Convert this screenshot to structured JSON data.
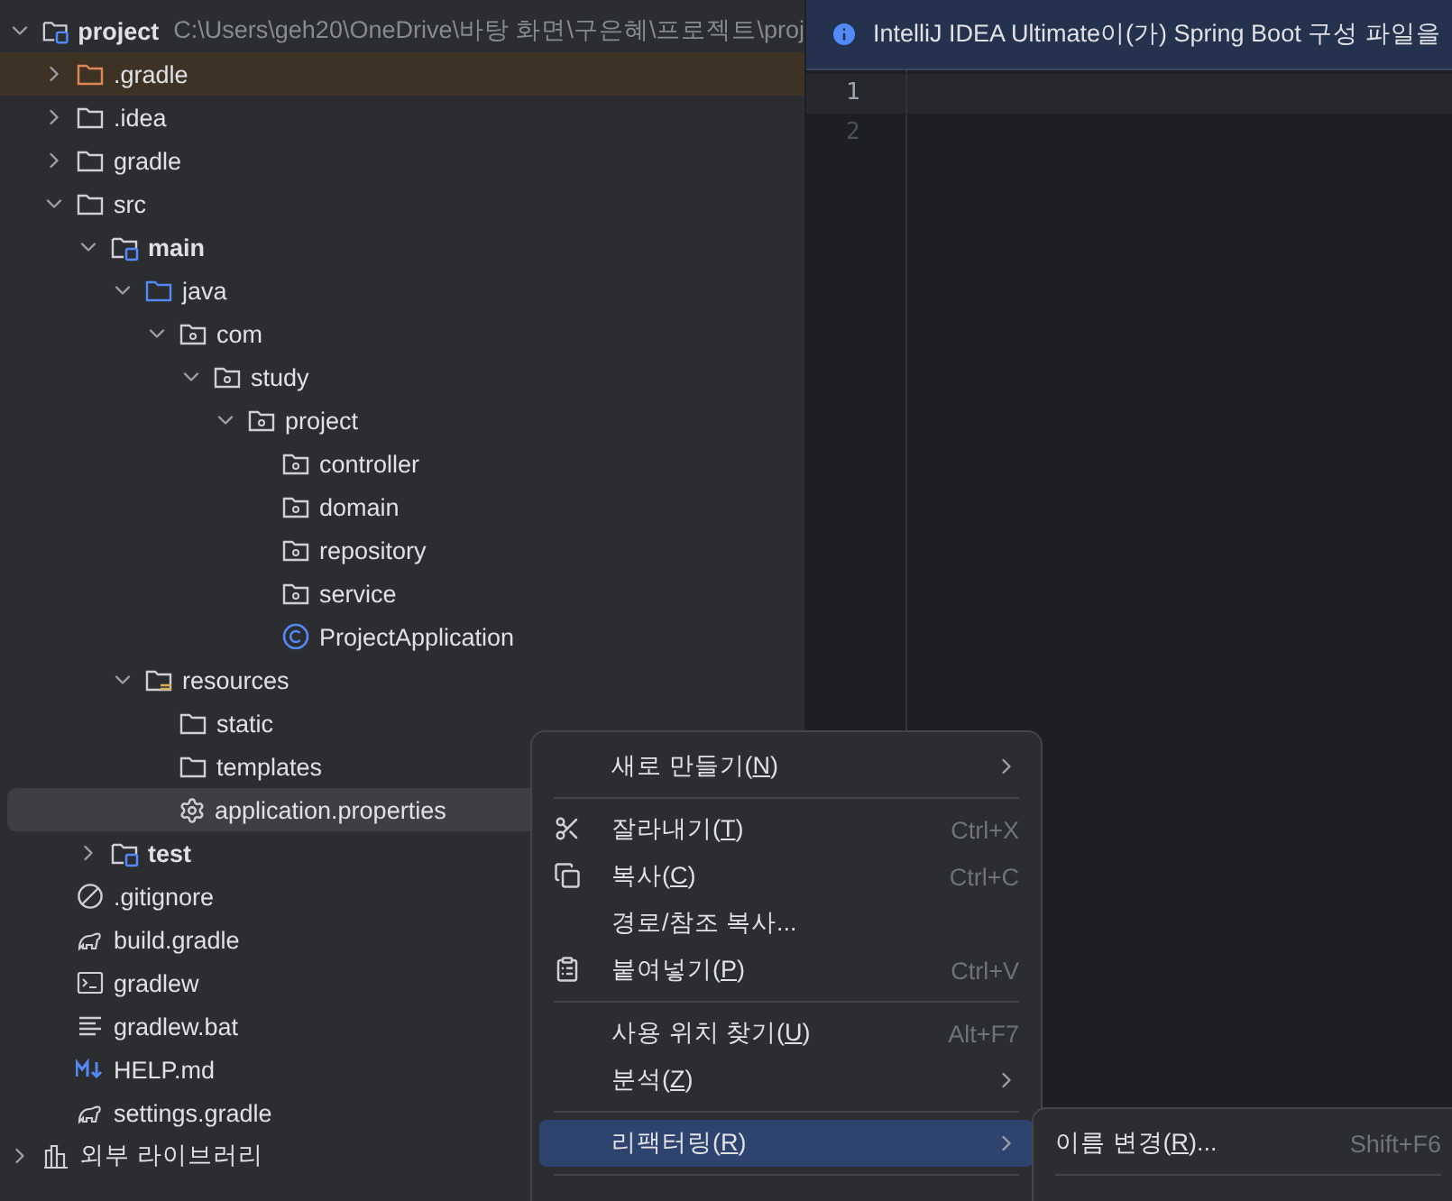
{
  "project_tree": [
    {
      "label": "project",
      "hint": "C:\\Users\\geh20\\OneDrive\\바탕 화면\\구은혜\\프로젝트\\proj",
      "kind": "module",
      "expanded": true,
      "children": [
        {
          "label": ".gradle",
          "kind": "excluded-folder",
          "expanded": false,
          "highlighted": true
        },
        {
          "label": ".idea",
          "kind": "folder",
          "expanded": false
        },
        {
          "label": "gradle",
          "kind": "folder",
          "expanded": false
        },
        {
          "label": "src",
          "kind": "folder",
          "expanded": true,
          "children": [
            {
              "label": "main",
              "kind": "module",
              "expanded": true,
              "children": [
                {
                  "label": "java",
                  "kind": "source-folder",
                  "expanded": true,
                  "children": [
                    {
                      "label": "com",
                      "kind": "package",
                      "expanded": true,
                      "children": [
                        {
                          "label": "study",
                          "kind": "package",
                          "expanded": true,
                          "children": [
                            {
                              "label": "project",
                              "kind": "package",
                              "expanded": true,
                              "children": [
                                {
                                  "label": "controller",
                                  "kind": "package"
                                },
                                {
                                  "label": "domain",
                                  "kind": "package"
                                },
                                {
                                  "label": "repository",
                                  "kind": "package"
                                },
                                {
                                  "label": "service",
                                  "kind": "package"
                                },
                                {
                                  "label": "ProjectApplication",
                                  "kind": "class"
                                }
                              ]
                            }
                          ]
                        }
                      ]
                    }
                  ]
                },
                {
                  "label": "resources",
                  "kind": "resources",
                  "expanded": true,
                  "children": [
                    {
                      "label": "static",
                      "kind": "folder"
                    },
                    {
                      "label": "templates",
                      "kind": "folder"
                    },
                    {
                      "label": "application.properties",
                      "kind": "gear",
                      "selected": true
                    }
                  ]
                }
              ]
            },
            {
              "label": "test",
              "kind": "module",
              "expanded": false
            }
          ]
        },
        {
          "label": ".gitignore",
          "kind": "ignore"
        },
        {
          "label": "build.gradle",
          "kind": "gradle"
        },
        {
          "label": "gradlew",
          "kind": "terminal"
        },
        {
          "label": "gradlew.bat",
          "kind": "text"
        },
        {
          "label": "HELP.md",
          "kind": "markdown"
        },
        {
          "label": "settings.gradle",
          "kind": "gradle"
        }
      ]
    },
    {
      "label": "외부 라이브러리",
      "kind": "library",
      "expanded": false
    }
  ],
  "notification": {
    "text": "IntelliJ IDEA Ultimate이(가) Spring Boot 구성 파일을"
  },
  "editor": {
    "line_numbers": [
      "1",
      "2"
    ]
  },
  "context_menu": [
    {
      "kind": "plain",
      "before": "새로 만들기(",
      "mnemonic": "N",
      "after": ")",
      "submenu": true
    },
    {
      "kind": "separator"
    },
    {
      "kind": "scissors",
      "before": "잘라내기(",
      "mnemonic": "T",
      "after": ")",
      "shortcut": "Ctrl+X"
    },
    {
      "kind": "copy",
      "before": "복사(",
      "mnemonic": "C",
      "after": ")",
      "shortcut": "Ctrl+C"
    },
    {
      "kind": "plain",
      "before": "경로/참조 복사..."
    },
    {
      "kind": "clipboard",
      "before": "붙여넣기(",
      "mnemonic": "P",
      "after": ")",
      "shortcut": "Ctrl+V"
    },
    {
      "kind": "separator"
    },
    {
      "kind": "plain",
      "before": "사용 위치 찾기(",
      "mnemonic": "U",
      "after": ")",
      "shortcut": "Alt+F7"
    },
    {
      "kind": "plain",
      "before": "분석(",
      "mnemonic": "Z",
      "after": ")",
      "submenu": true
    },
    {
      "kind": "separator"
    },
    {
      "kind": "plain",
      "before": "리팩터링(",
      "mnemonic": "R",
      "after": ")",
      "submenu": true,
      "selected": true
    },
    {
      "kind": "separator"
    }
  ],
  "submenu": [
    {
      "kind": "plain",
      "before": "이름 변경(",
      "mnemonic": "R",
      "after": ")...",
      "shortcut": "Shift+F6"
    },
    {
      "kind": "separator"
    }
  ]
}
